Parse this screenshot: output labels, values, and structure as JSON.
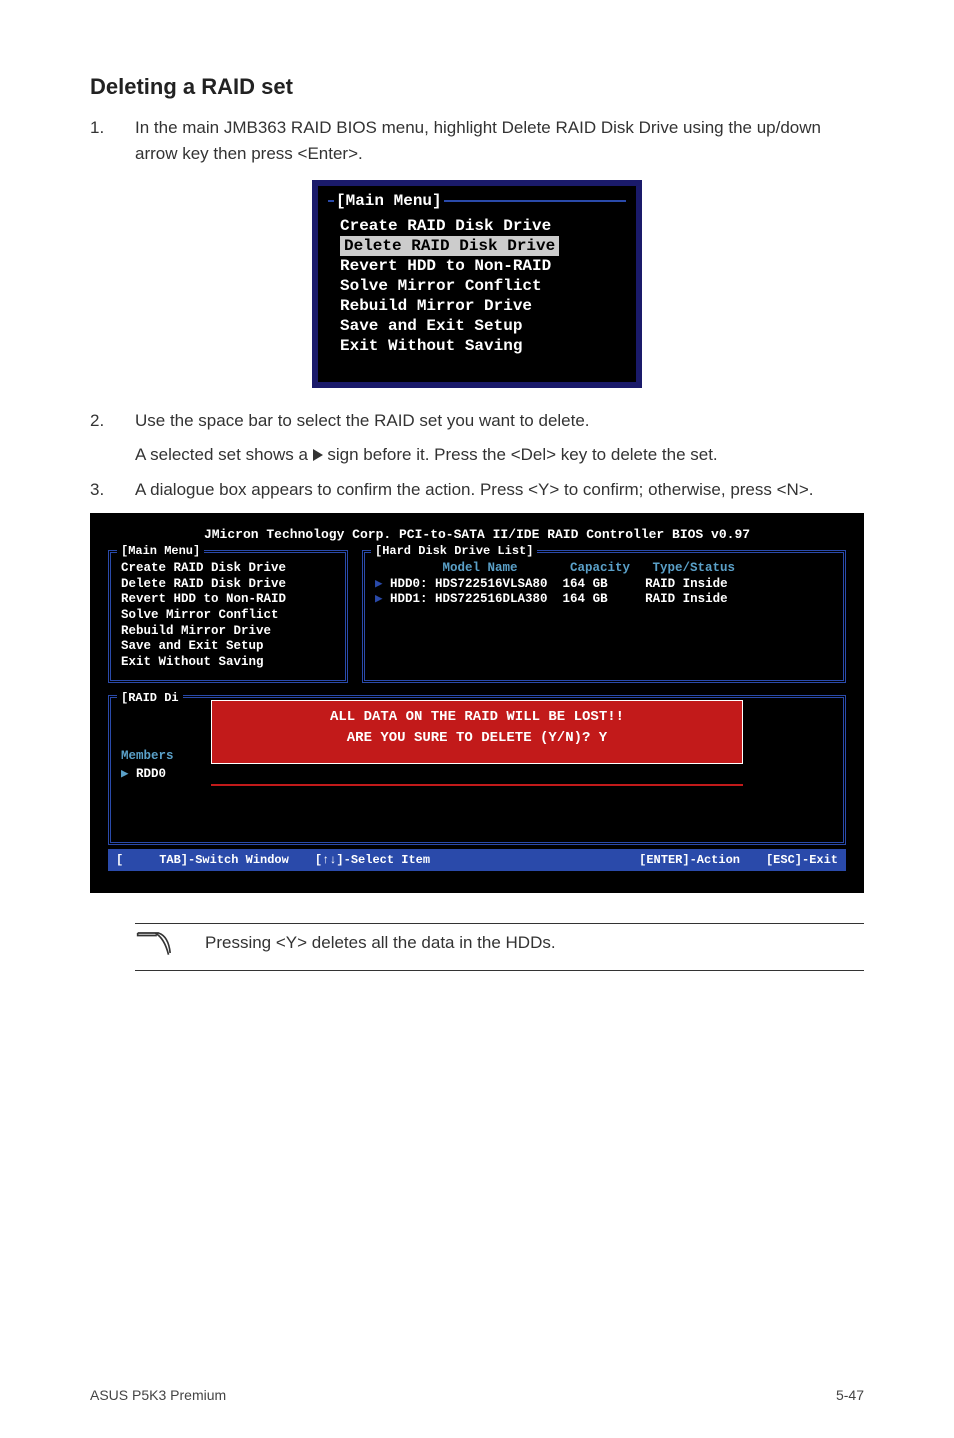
{
  "heading": "Deleting a RAID set",
  "steps": {
    "s1": {
      "num": "1.",
      "text": "In the main JMB363 RAID BIOS menu, highlight Delete RAID Disk Drive using the up/down arrow key then press <Enter>."
    },
    "s2": {
      "num": "2.",
      "text": "Use the space bar to select the RAID set you want to delete.",
      "sub": "A selected set shows a    sign before it. Press the <Del> key to delete the set."
    },
    "s3": {
      "num": "3.",
      "text": "A dialogue box appears to confirm the action. Press <Y> to confirm; otherwise, press <N>."
    }
  },
  "small_menu": {
    "title": "[Main Menu]",
    "items": [
      "Create RAID Disk Drive",
      "Delete RAID Disk Drive",
      "Revert HDD to Non-RAID",
      "Solve Mirror Conflict",
      "Rebuild Mirror Drive",
      "Save and Exit Setup",
      "Exit Without Saving"
    ]
  },
  "big": {
    "top": "JMicron Technology Corp. PCI-to-SATA II/IDE RAID Controller BIOS v0.97",
    "main_label": "[Main Menu]",
    "hdd_label": "[Hard Disk Drive List]",
    "main_items": [
      "Create RAID Disk Drive",
      "Delete RAID Disk Drive",
      "Revert HDD to Non-RAID",
      "Solve Mirror Conflict",
      "Rebuild Mirror Drive",
      "Save and Exit Setup",
      "Exit Without Saving"
    ],
    "hdd_header": "         Model Name       Capacity   Type/Status",
    "hdd_rows": [
      "HDD0: HDS722516VLSA80  164 GB     RAID Inside",
      "HDD1: HDS722516DLA380  164 GB     RAID Inside"
    ],
    "raid_label": "[RAID Di",
    "members": "Members",
    "rdd": "RDD0",
    "modal_line1": "ALL DATA ON THE RAID WILL BE LOST!!",
    "modal_line2": "ARE YOU SURE TO DELETE (Y/N)? Y",
    "bottom": {
      "a": "[     TAB]-Switch Window",
      "b": "[↑↓]-Select Item",
      "c": "[ENTER]-Action",
      "d": "[ESC]-Exit"
    }
  },
  "note": "Pressing <Y> deletes all the data in the HDDs.",
  "footer": {
    "left": "ASUS P5K3 Premium",
    "right": "5-47"
  }
}
